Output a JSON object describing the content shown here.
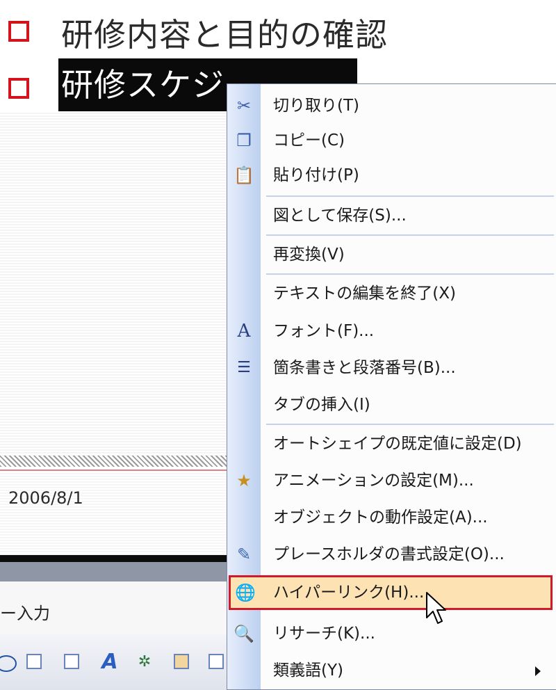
{
  "slide": {
    "bullet1": "研修内容と目的の確認",
    "bullet2": "研修スケジ",
    "date": "2006/8/1"
  },
  "statusbar": {
    "text": "ー入力"
  },
  "context_menu": {
    "items": [
      {
        "label": "切り取り(T)",
        "icon": "scissors-icon"
      },
      {
        "label": "コピー(C)",
        "icon": "copy-icon"
      },
      {
        "label": "貼り付け(P)",
        "icon": "paste-icon"
      },
      {
        "label": "図として保存(S)...",
        "icon": ""
      },
      {
        "label": "再変換(V)",
        "icon": ""
      },
      {
        "label": "テキストの編集を終了(X)",
        "icon": ""
      },
      {
        "label": "フォント(F)...",
        "icon": "font-icon"
      },
      {
        "label": "箇条書きと段落番号(B)...",
        "icon": "bullets-icon"
      },
      {
        "label": "タブの挿入(I)",
        "icon": ""
      },
      {
        "label": "オートシェイプの既定値に設定(D)",
        "icon": ""
      },
      {
        "label": "アニメーションの設定(M)...",
        "icon": "animation-icon"
      },
      {
        "label": "オブジェクトの動作設定(A)...",
        "icon": ""
      },
      {
        "label": "プレースホルダの書式設定(O)...",
        "icon": "format-placeholder-icon"
      },
      {
        "label": "ハイパーリンク(H)...",
        "icon": "hyperlink-globe-icon",
        "highlighted": true
      },
      {
        "label": "リサーチ(K)...",
        "icon": "research-icon"
      },
      {
        "label": "類義語(Y)",
        "icon": "",
        "submenu": true
      }
    ]
  },
  "colors": {
    "bullet_red": "#d4141d",
    "highlight_fill": "#fde3b4",
    "highlight_border": "#d11a28",
    "menu_gutter": "#bcd0f0"
  }
}
